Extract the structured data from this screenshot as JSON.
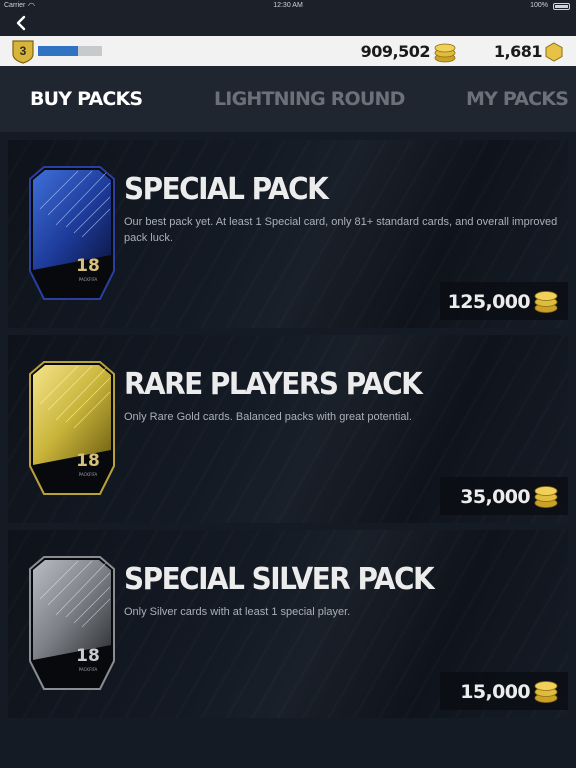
{
  "status_bar": {
    "carrier": "Carrier",
    "wifi_icon": "wifi-icon",
    "time": "12:30 AM",
    "battery": "100%"
  },
  "nav": {
    "back_icon": "chevron-left-icon"
  },
  "currency": {
    "level": "3",
    "xp_progress": 0.63,
    "coins": "909,502",
    "points": "1,681"
  },
  "tabs": [
    {
      "label": "BUY PACKS",
      "active": true
    },
    {
      "label": "LIGHTNING ROUND",
      "active": false
    },
    {
      "label": "MY PACKS",
      "active": false
    }
  ],
  "packs": [
    {
      "title": "SPECIAL PACK",
      "description": "Our best pack yet. At least 1 Special card, only 81+ standard cards, and overall improved pack luck.",
      "price": "125,000",
      "color": "#1f3f9e",
      "pack_number": "18",
      "pack_brand": "PACKFIFA"
    },
    {
      "title": "RARE PLAYERS PACK",
      "description": "Only Rare Gold cards. Balanced packs with great potential.",
      "price": "35,000",
      "color": "#c9b43a",
      "pack_number": "18",
      "pack_brand": "PACKFIFA"
    },
    {
      "title": "SPECIAL SILVER PACK",
      "description": "Only Silver cards with at least 1 special player.",
      "price": "15,000",
      "color": "#8a8d92",
      "pack_number": "18",
      "pack_brand": "PACKFIFA"
    }
  ]
}
